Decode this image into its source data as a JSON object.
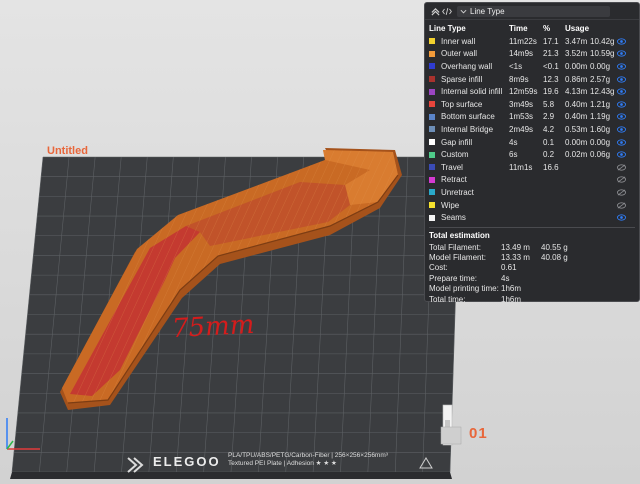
{
  "viewport": {
    "plate_title": "Untitled",
    "plate_number": "01",
    "annotation": "75mm",
    "plate_logo": "ELEGOO",
    "plate_spec_line1": "PLA/TPU/ABS/PETG/Carbon-Fiber | 256×256×256mm³",
    "plate_spec_line2": "Textured PEI Plate | Adhesion ★ ★ ★"
  },
  "panel": {
    "header": {
      "dropdown_label": "Line Type"
    },
    "columns": {
      "type": "Line Type",
      "time": "Time",
      "percent": "%",
      "usage": "Usage"
    },
    "rows": [
      {
        "name": "Inner wall",
        "color": "#f2d12e",
        "time": "11m22s",
        "percent": "17.1",
        "length": "3.47m",
        "mass": "10.42g",
        "visible": true
      },
      {
        "name": "Outer wall",
        "color": "#f29b3a",
        "time": "14m9s",
        "percent": "21.3",
        "length": "3.52m",
        "mass": "10.59g",
        "visible": true
      },
      {
        "name": "Overhang wall",
        "color": "#2f3cd1",
        "time": "<1s",
        "percent": "<0.1",
        "length": "0.00m",
        "mass": "0.00g",
        "visible": true
      },
      {
        "name": "Sparse infill",
        "color": "#a8322d",
        "time": "8m9s",
        "percent": "12.3",
        "length": "0.86m",
        "mass": "2.57g",
        "visible": true
      },
      {
        "name": "Internal solid infill",
        "color": "#9b45c2",
        "time": "12m59s",
        "percent": "19.6",
        "length": "4.13m",
        "mass": "12.43g",
        "visible": true
      },
      {
        "name": "Top surface",
        "color": "#e8453c",
        "time": "3m49s",
        "percent": "5.8",
        "length": "0.40m",
        "mass": "1.21g",
        "visible": true
      },
      {
        "name": "Bottom surface",
        "color": "#5a84c9",
        "time": "1m53s",
        "percent": "2.9",
        "length": "0.40m",
        "mass": "1.19g",
        "visible": true
      },
      {
        "name": "Internal Bridge",
        "color": "#6d8fb8",
        "time": "2m49s",
        "percent": "4.2",
        "length": "0.53m",
        "mass": "1.60g",
        "visible": true
      },
      {
        "name": "Gap infill",
        "color": "#ffffff",
        "time": "4s",
        "percent": "0.1",
        "length": "0.00m",
        "mass": "0.00g",
        "visible": true
      },
      {
        "name": "Custom",
        "color": "#4fcb8a",
        "time": "6s",
        "percent": "0.2",
        "length": "0.02m",
        "mass": "0.06g",
        "visible": true
      },
      {
        "name": "Travel",
        "color": "#3a4bb5",
        "time": "11m1s",
        "percent": "16.6",
        "length": "",
        "mass": "",
        "visible": false
      },
      {
        "name": "Retract",
        "color": "#d43ad1",
        "time": "",
        "percent": "",
        "length": "",
        "mass": "",
        "visible": false
      },
      {
        "name": "Unretract",
        "color": "#2aa9c9",
        "time": "",
        "percent": "",
        "length": "",
        "mass": "",
        "visible": false
      },
      {
        "name": "Wipe",
        "color": "#f5e12e",
        "time": "",
        "percent": "",
        "length": "",
        "mass": "",
        "visible": false
      },
      {
        "name": "Seams",
        "color": "#f4f4f4",
        "time": "",
        "percent": "",
        "length": "",
        "mass": "",
        "visible": true
      }
    ],
    "estimation": {
      "title": "Total estimation",
      "items": [
        {
          "label": "Total Filament:",
          "v1": "13.49 m",
          "v2": "40.55 g"
        },
        {
          "label": "Model Filament:",
          "v1": "13.33 m",
          "v2": "40.08 g"
        },
        {
          "label": "Cost:",
          "v1": "0.61",
          "v2": ""
        },
        {
          "label": "Prepare time:",
          "v1": "4s",
          "v2": ""
        },
        {
          "label": "Model printing time:",
          "v1": "1h6m",
          "v2": ""
        },
        {
          "label": "Total time:",
          "v1": "1h6m",
          "v2": ""
        }
      ]
    }
  },
  "colors": {
    "plate": "#3b3d40",
    "grid": "#5d6063",
    "model_body": "#c96a24",
    "model_highlight": "#e58a3a",
    "model_infill": "#c43a30",
    "eye_on": "#2f7cf6",
    "eye_off": "#8a8b8f",
    "accent": "#e8663a"
  },
  "icons": {
    "collapse": "chevron-up-icon",
    "code": "code-icon",
    "eye_on": "eye-icon",
    "eye_off": "eye-slash-icon"
  }
}
